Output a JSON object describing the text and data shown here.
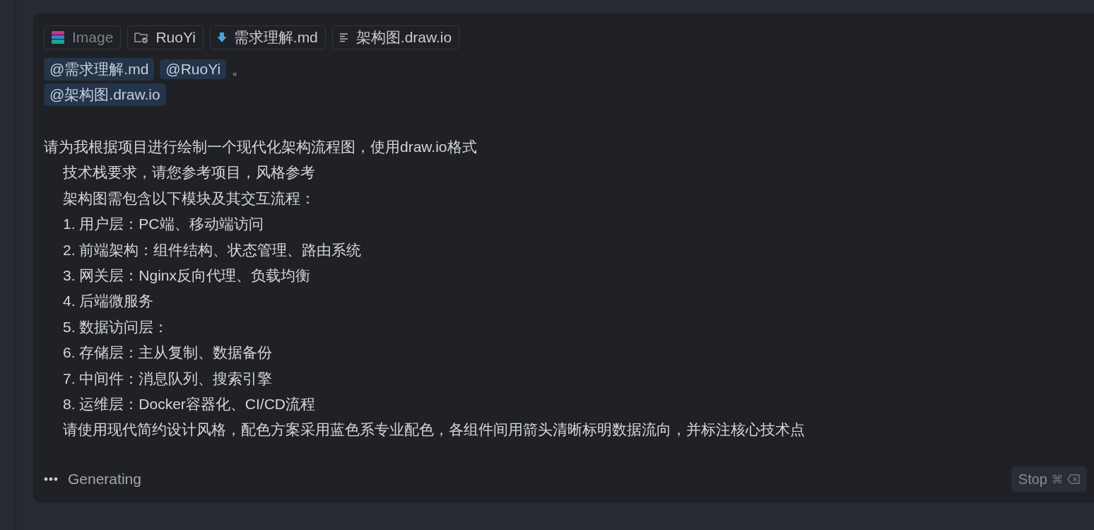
{
  "attachments": [
    {
      "kind": "image",
      "label": "Image"
    },
    {
      "kind": "folder",
      "label": "RuoYi"
    },
    {
      "kind": "markdown",
      "label": "需求理解.md"
    },
    {
      "kind": "document",
      "label": "架构图.draw.io"
    }
  ],
  "mention_lines": [
    [
      {
        "kind": "mention",
        "text": "@需求理解.md"
      },
      {
        "kind": "mention",
        "text": "@RuoYi"
      },
      {
        "kind": "plain",
        "text": "。"
      }
    ],
    [
      {
        "kind": "mention",
        "text": "@架构图.draw.io"
      }
    ]
  ],
  "prompt": {
    "first_line": "请为我根据项目进行绘制一个现代化架构流程图，使用draw.io格式",
    "indented_lines": [
      "技术栈要求，请您参考项目，风格参考",
      "架构图需包含以下模块及其交互流程：",
      "1. 用户层：PC端、移动端访问",
      "2. 前端架构：组件结构、状态管理、路由系统",
      "3. 网关层：Nginx反向代理、负载均衡",
      "4. 后端微服务",
      "5. 数据访问层：",
      "6. 存储层：主从复制、数据备份",
      "7. 中间件：消息队列、搜索引擎",
      "8. 运维层：Docker容器化、CI/CD流程",
      "请使用现代简约设计风格，配色方案采用蓝色系专业配色，各组件间用箭头清晰标明数据流向，并标注核心技术点"
    ]
  },
  "status": {
    "label": "Generating"
  },
  "stop_button": {
    "label": "Stop",
    "shortcut": "⌘"
  }
}
